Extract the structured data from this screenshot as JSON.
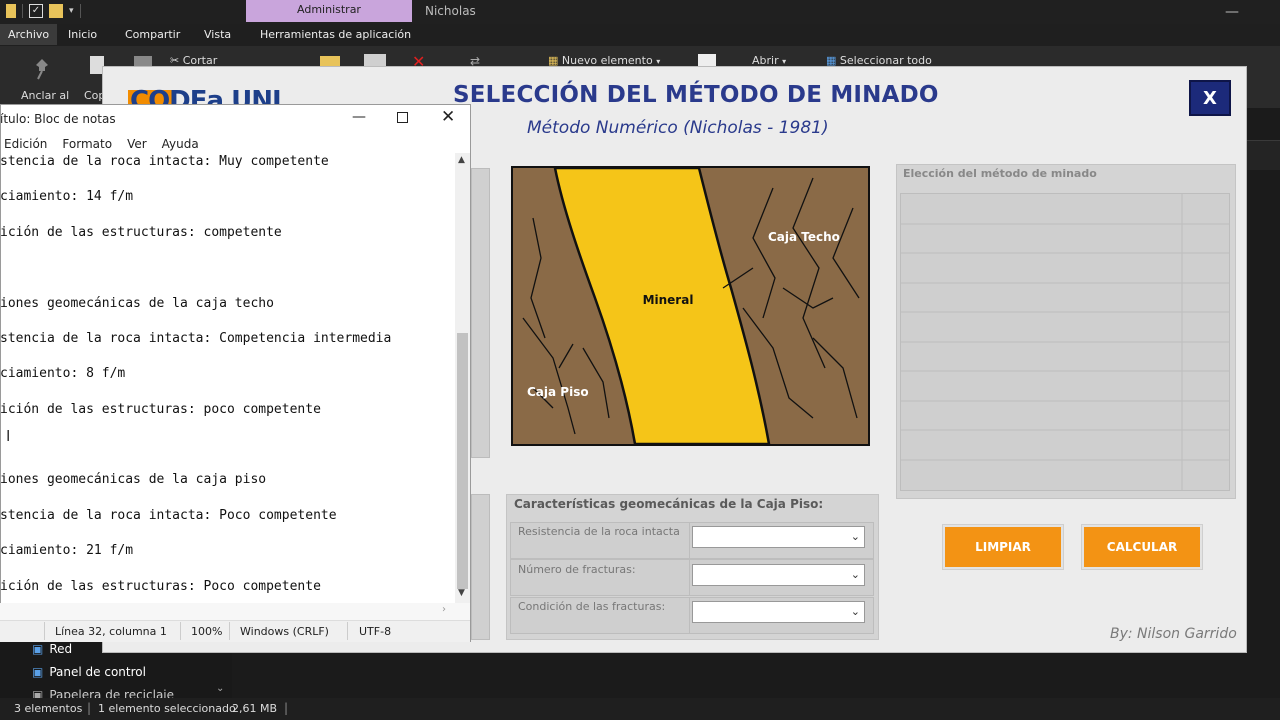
{
  "explorer": {
    "context_tab": "Administrar",
    "window_title": "Nicholas",
    "ribbon_tabs": [
      "Archivo",
      "Inicio",
      "Compartir",
      "Vista",
      "Herramientas de aplicación"
    ],
    "ribbon": {
      "pin_label": "Anclar al",
      "copy_label": "Cop",
      "cut": "Cortar",
      "new_item": "Nuevo elemento",
      "open": "Abrir",
      "select_all": "Seleccionar todo"
    },
    "nav": {
      "red": "Red",
      "panel": "Panel de control",
      "recycle": "Papelera de reciclaje"
    },
    "status": {
      "count": "3 elementos",
      "selected": "1 elemento seleccionado",
      "size": "2,61 MB"
    }
  },
  "app": {
    "logo_text": "CODEa UNI",
    "title": "SELECCIÓN DEL MÉTODO DE MINADO",
    "subtitle": "Método Numérico (Nicholas - 1981)",
    "close_label": "X",
    "diagram": {
      "label_mineral": "Mineral",
      "label_techo": "Caja Techo",
      "label_piso": "Caja Piso"
    },
    "results": {
      "label": "Elección del método de minado",
      "rows": 10
    },
    "piso_panel": {
      "title": "Características geomecánicas de la Caja Piso:",
      "fields": [
        {
          "label": "Resistencia de la roca intacta",
          "value": ""
        },
        {
          "label": "Número de fracturas:",
          "value": ""
        },
        {
          "label": "Condición de las fracturas:",
          "value": ""
        }
      ]
    },
    "buttons": {
      "clear": "LIMPIAR",
      "calculate": "CALCULAR"
    },
    "byline": "By: Nilson Garrido"
  },
  "notepad": {
    "title": "ítulo: Bloc de notas",
    "menu": [
      "Edición",
      "Formato",
      "Ver",
      "Ayuda"
    ],
    "lines": [
      "stencia de la roca intacta: Muy competente",
      "",
      "ciamiento: 14 f/m",
      "",
      "ición de las estructuras: competente",
      "",
      "",
      "",
      "iones geomecánicas de la caja techo",
      "",
      "stencia de la roca intacta: Competencia intermedia",
      "",
      "ciamiento: 8 f/m",
      "",
      "ición de las estructuras: poco competente",
      "",
      "",
      "",
      "iones geomecánicas de la caja piso",
      "",
      "stencia de la roca intacta: Poco competente",
      "",
      "ciamiento: 21 f/m",
      "",
      "ición de las estructuras: Poco competente"
    ],
    "status": {
      "position": "Línea 32, columna 1",
      "zoom": "100%",
      "eol": "Windows (CRLF)",
      "encoding": "UTF-8"
    }
  }
}
